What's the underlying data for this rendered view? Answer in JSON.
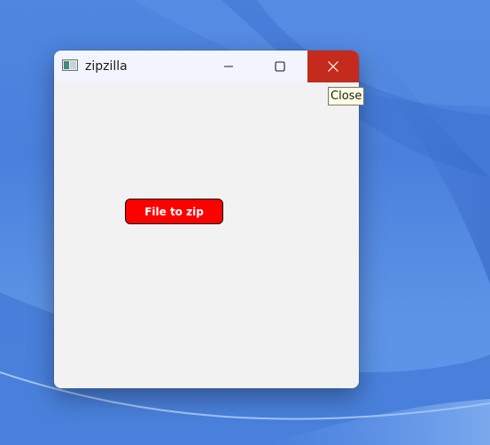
{
  "window": {
    "title": "zipzilla",
    "icon": "app-window-icon",
    "controls": {
      "minimize_icon": "minimize-icon",
      "maximize_icon": "maximize-icon",
      "close_icon": "close-icon",
      "close_hover_color": "#c42b1c"
    }
  },
  "content": {
    "file_button_label": "File to zip",
    "file_button_color": "#ff0000"
  },
  "tooltip": {
    "text": "Close"
  }
}
